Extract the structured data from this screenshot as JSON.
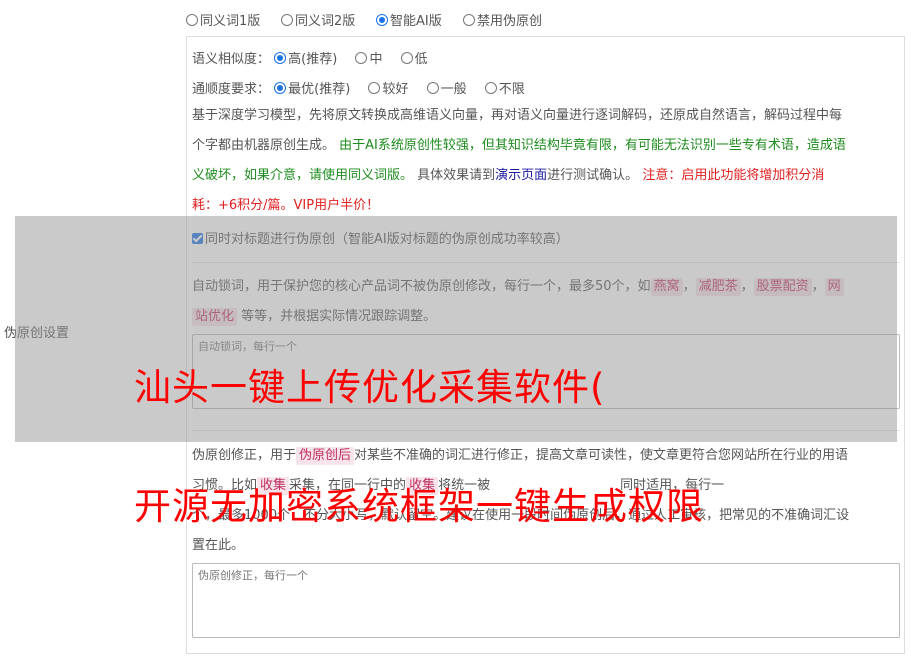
{
  "top_options": [
    {
      "label": "同义词1版",
      "checked": false
    },
    {
      "label": "同义词2版",
      "checked": false
    },
    {
      "label": "智能AI版",
      "checked": true
    },
    {
      "label": "禁用伪原创",
      "checked": false
    }
  ],
  "side_label": "伪原创设置",
  "similarity": {
    "label": "语义相似度：",
    "options": [
      {
        "label": "高(推荐)",
        "checked": true
      },
      {
        "label": "中",
        "checked": false
      },
      {
        "label": "低",
        "checked": false
      }
    ]
  },
  "fluency": {
    "label": "通顺度要求：",
    "options": [
      {
        "label": "最优(推荐)",
        "checked": true
      },
      {
        "label": "较好",
        "checked": false
      },
      {
        "label": "一般",
        "checked": false
      },
      {
        "label": "不限",
        "checked": false
      }
    ]
  },
  "description": {
    "line1": "基于深度学习模型，先将原文转换成高维语义向量，再对语义向量进行逐词解码，还原成自然语言，解码过程中每",
    "line2_plain": "个字都由机器原创生成。 ",
    "line2_green": "由于AI系统原创性较强，但其知识结构毕竟有限，有可能无法识别一些专有术语，造成语",
    "line3_green": "义破坏，如果介意，请使用同义词版。",
    "line3_plain": " 具体效果请到",
    "line3_link": "演示页面",
    "line3_plain2": "进行测试确认。 ",
    "line3_red": "注意：启用此功能将增加积分消",
    "line4_red": "耗：+6积分/篇。VIP用户半价！"
  },
  "title_checkbox_label": "同时对标题进行伪原创（智能AI版对标题的伪原创成功率较高）",
  "lock": {
    "text1": "自动锁词，用于保护您的核心产品词不被伪原创修改，每行一个，最多50个，如",
    "chips": [
      "燕窝",
      "减肥茶",
      "股票配资",
      "网"
    ],
    "chip_last_cont": "站优化",
    "text2": " 等等，并根据实际情况跟踪调整。",
    "placeholder": "自动锁词，每行一个"
  },
  "fix": {
    "text1_a": "伪原创修正，用于",
    "text1_chip": "伪原创后",
    "text1_b": "对某些不准确的词汇进行修正，提高文章可读性，使文章更符合您网站所在行业的用语",
    "text2_a": "习惯。比如",
    "text2_chip1": "收集",
    "text2_b": "采集",
    "text2_c": "，在同一行中的",
    "text2_chip2": "收集",
    "text2_d": "将统一被",
    "text2_e": "同时适用，每行一",
    "text3": "个，最多1000个，不分大小写，默认留空。建议在使用一段时间伪原创后，通过人工审核，把常见的不准确词汇设",
    "text4": "置在此。",
    "placeholder": "伪原创修正，每行一个"
  },
  "watermark": {
    "line1": "汕头一键上传优化采集软件(",
    "line2": "开源无加密系统框架一键生成权限"
  }
}
